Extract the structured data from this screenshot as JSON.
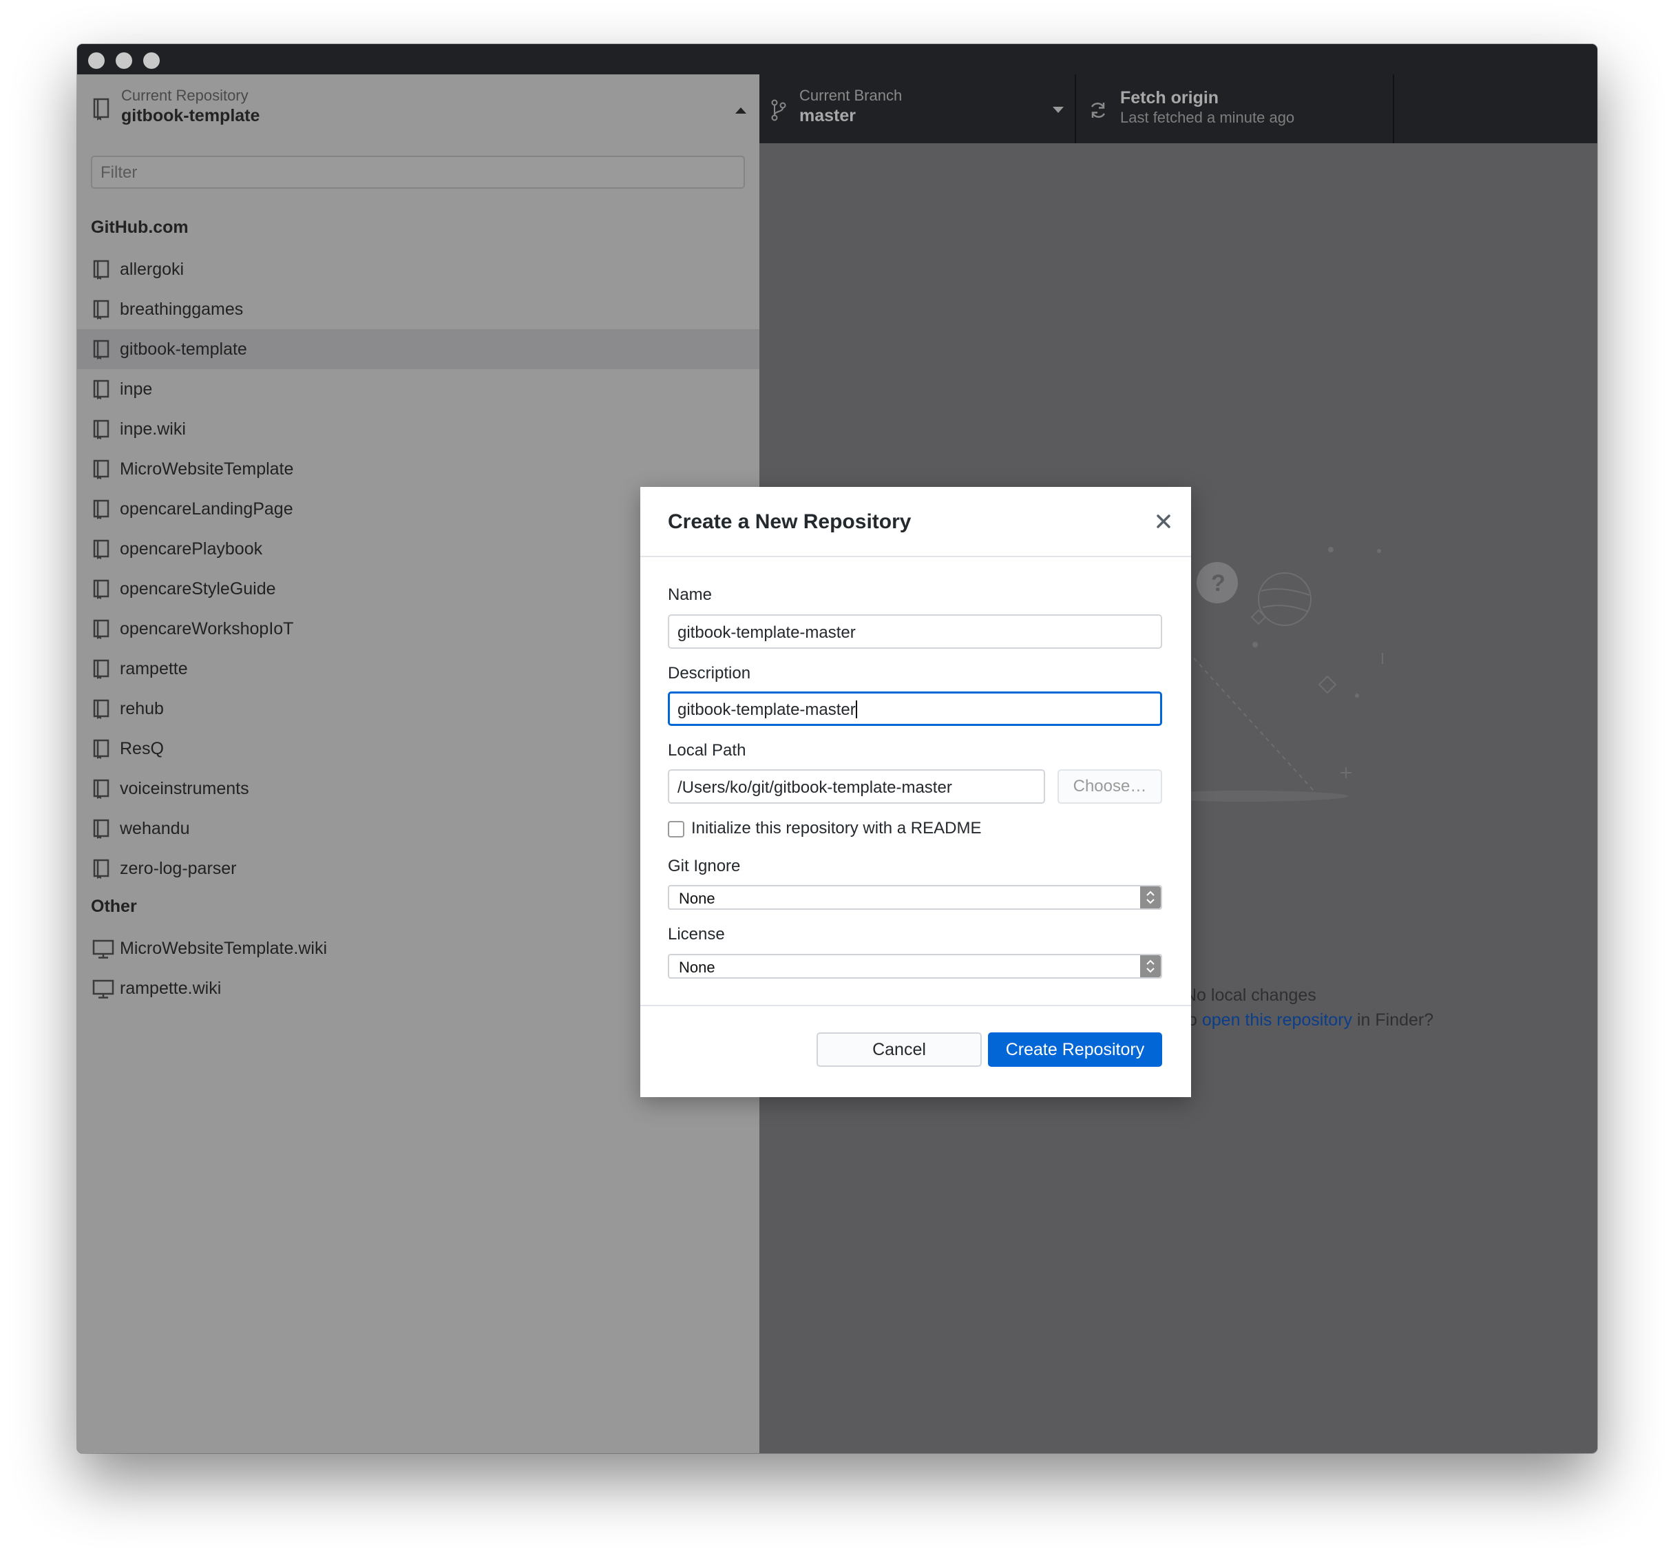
{
  "toolbar": {
    "repository": {
      "label": "Current Repository",
      "value": "gitbook-template"
    },
    "branch": {
      "label": "Current Branch",
      "value": "master"
    },
    "fetch": {
      "label": "Fetch origin",
      "status": "Last fetched a minute ago"
    }
  },
  "sidebar": {
    "filter_placeholder": "Filter",
    "groups": [
      {
        "title": "GitHub.com",
        "items": [
          {
            "label": "allergoki"
          },
          {
            "label": "breathinggames"
          },
          {
            "label": "gitbook-template",
            "selected": true
          },
          {
            "label": "inpe"
          },
          {
            "label": "inpe.wiki"
          },
          {
            "label": "MicroWebsiteTemplate"
          },
          {
            "label": "opencareLandingPage"
          },
          {
            "label": "opencarePlaybook"
          },
          {
            "label": "opencareStyleGuide"
          },
          {
            "label": "opencareWorkshopIoT"
          },
          {
            "label": "rampette"
          },
          {
            "label": "rehub"
          },
          {
            "label": "ResQ"
          },
          {
            "label": "voiceinstruments"
          },
          {
            "label": "wehandu"
          },
          {
            "label": "zero-log-parser"
          }
        ]
      },
      {
        "title": "Other",
        "items": [
          {
            "label": "MicroWebsiteTemplate.wiki"
          },
          {
            "label": "rampette.wiki"
          }
        ]
      }
    ]
  },
  "empty_state": {
    "title_partial": "No local changes",
    "prefix_partial": "o ",
    "link": "open this repository",
    "suffix": " in Finder?"
  },
  "dialog": {
    "title": "Create a New Repository",
    "name": {
      "label": "Name",
      "value": "gitbook-template-master"
    },
    "description": {
      "label": "Description",
      "value": "gitbook-template-master"
    },
    "local_path": {
      "label": "Local Path",
      "value": "/Users/ko/git/gitbook-template-master",
      "choose_label": "Choose…"
    },
    "readme": {
      "label": "Initialize this repository with a README",
      "checked": false
    },
    "git_ignore": {
      "label": "Git Ignore",
      "value": "None"
    },
    "license": {
      "label": "License",
      "value": "None"
    },
    "cancel_label": "Cancel",
    "create_label": "Create Repository"
  },
  "colors": {
    "accent": "#0366d6",
    "toolbar_bg": "#1f2124",
    "sidebar_bg": "#989898",
    "content_bg": "#5b5b5d",
    "link": "#0a3e8a"
  }
}
